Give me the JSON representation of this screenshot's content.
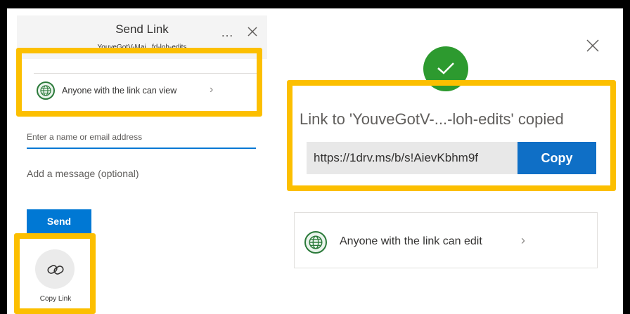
{
  "share_panel": {
    "title": "Send Link",
    "subtitle": "YouveGotV-Mai...fd-loh-edits",
    "more_label": "…",
    "permission_label": "Anyone with the link can view",
    "permission_chevron": "›",
    "name_placeholder": "Enter a name or email address",
    "message_placeholder": "Add a message (optional)",
    "send_label": "Send",
    "copy_link_label": "Copy Link"
  },
  "copied_panel": {
    "copied_message": "Link to 'YouveGotV-...-loh-edits' copied",
    "link_value": "https://1drv.ms/b/s!AievKbhm9f",
    "copy_label": "Copy",
    "permission_label": "Anyone with the link can edit",
    "permission_chevron": "›"
  },
  "colors": {
    "accent": "#0078d4",
    "success": "#2d9a2f",
    "highlight": "#fcbf00",
    "globe": "#2b7a3a"
  },
  "icons": {
    "more": "ellipsis-icon",
    "close": "close-icon",
    "globe": "globe-icon",
    "link": "link-icon",
    "check": "checkmark-icon",
    "chevron": "chevron-right-icon"
  }
}
